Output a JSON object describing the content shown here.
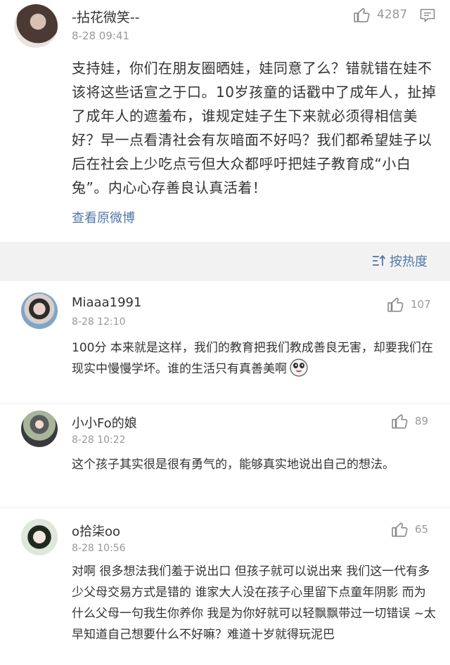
{
  "main_post": {
    "username": "-拈花微笑--",
    "time": "8-28 09:41",
    "like_count": "4287",
    "text": "支持娃，你们在朋友圈晒娃，娃同意了么？错就错在娃不该将这些话宣之于口。10岁孩童的话戳中了成年人，扯掉了成年人的遮羞布，谁规定娃子生下来就必须得相信美好？早一点看清社会有灰暗面不好吗？我们都希望娃子以后在社会上少吃点亏但大众都呼吁把娃子教育成“小白兔”。内心心存善良认真活着！",
    "view_original_label": "查看原微博"
  },
  "sort": {
    "label": "按热度"
  },
  "comments": [
    {
      "username": "Miaaa1991",
      "time": "8-28 12:10",
      "like_count": "107",
      "text": "100分 本来就是这样，我们的教育把我们教成善良无害，却要我们在现实中慢慢学坏。谁的生活只有真善美啊"
    },
    {
      "username": "小小Fo的娘",
      "time": "8-28 10:22",
      "like_count": "89",
      "text": "这个孩子其实很是很有勇气的，能够真实地说出自己的想法。"
    },
    {
      "username": "o拾柒oo",
      "time": "8-28 10:56",
      "like_count": "65",
      "text": "对啊 很多想法我们羞于说出口 但孩子就可以说出来 我们这一代有多少父母交易方式是错的 谁家大人没在孩子心里留下点童年阴影 而为什么父母一句我生你养你 我是为你好就可以轻飘飘带过一切错误 ~太早知道自己想要什么不好嘛？难道十岁就得玩泥巴"
    }
  ],
  "icons": {
    "like": "thumbs-up-icon",
    "comment": "comment-icon",
    "sort": "sort-icon",
    "emoji": "emoji-icon"
  },
  "colors": {
    "link": "#5078a9",
    "meta": "#999999",
    "text": "#333333",
    "separator_bg": "#f2f2f2"
  }
}
